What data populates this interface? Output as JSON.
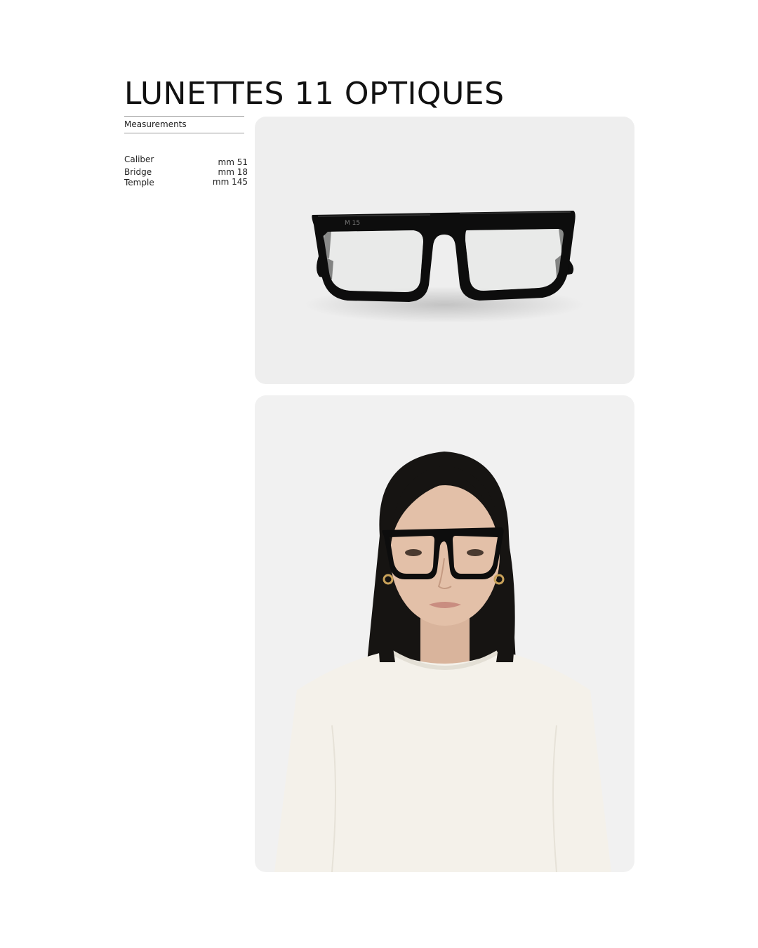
{
  "product": {
    "title": "LUNETTES 11 OPTIQUES"
  },
  "measurements": {
    "heading": "Measurements",
    "rows": [
      {
        "label": "Caliber",
        "value": "mm 51"
      },
      {
        "label": "Bridge",
        "value": "mm 18"
      },
      {
        "label": "Temple",
        "value": "mm 145"
      }
    ]
  },
  "photos": {
    "product_shot": {
      "frame_brand_mark": "M 15",
      "icon": "folded-black-eyeglasses-icon"
    },
    "model_shot": {
      "icon": "model-wearing-glasses-icon"
    }
  },
  "colors": {
    "frame": "#0d0d0d",
    "card_background": "#efefef",
    "shirt": "#f4f1ea",
    "hair": "#161412"
  }
}
